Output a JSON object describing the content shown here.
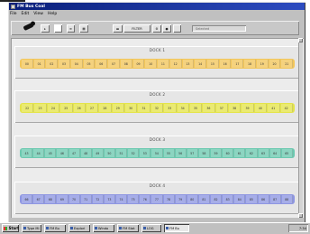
{
  "window": {
    "title": "FM Bus Coal",
    "menu": [
      "File",
      "Edit",
      "View",
      "Help"
    ]
  },
  "toolbar": {
    "filter_label": "FILTER",
    "field_text": "Selected"
  },
  "docks": [
    {
      "title": "DOCK 1",
      "color": "#f2c65a",
      "slots": [
        "00",
        "01",
        "02",
        "03",
        "04",
        "05",
        "06",
        "07",
        "08",
        "09",
        "10",
        "11",
        "12",
        "13",
        "14",
        "15",
        "16",
        "17",
        "18",
        "19",
        "20",
        "21"
      ]
    },
    {
      "title": "DOCK 2",
      "color": "#e4e44a",
      "slots": [
        "22",
        "23",
        "24",
        "25",
        "26",
        "27",
        "28",
        "29",
        "30",
        "31",
        "32",
        "33",
        "34",
        "35",
        "36",
        "37",
        "38",
        "39",
        "40",
        "41",
        "42"
      ]
    },
    {
      "title": "DOCK 3",
      "color": "#6cc9b0",
      "slots": [
        "43",
        "44",
        "45",
        "46",
        "47",
        "48",
        "49",
        "50",
        "51",
        "52",
        "53",
        "54",
        "55",
        "56",
        "57",
        "58",
        "59",
        "60",
        "61",
        "62",
        "63",
        "64",
        "65"
      ]
    },
    {
      "title": "DOCK 4",
      "color": "#8e96e2",
      "slots": [
        "66",
        "67",
        "68",
        "69",
        "70",
        "71",
        "72",
        "73",
        "74",
        "75",
        "76",
        "77",
        "78",
        "79",
        "80",
        "81",
        "82",
        "83",
        "84",
        "85",
        "86",
        "87",
        "88"
      ]
    }
  ],
  "taskbar": {
    "start_label": "Start",
    "tasks": [
      {
        "label": "Type Mi"
      },
      {
        "label": "FM Bu"
      },
      {
        "label": "Explori"
      },
      {
        "label": "Windo"
      },
      {
        "label": "FM Stat"
      },
      {
        "label": "LOG"
      },
      {
        "label": "FM Bu"
      }
    ],
    "clock": "7:34"
  }
}
